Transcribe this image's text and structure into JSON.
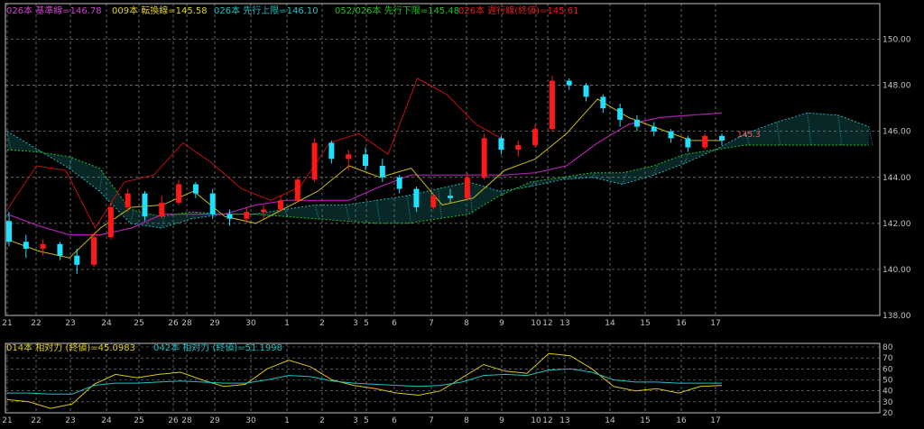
{
  "main_legend": [
    {
      "text": "026本 基準線=146.78",
      "color": "#d040d0"
    },
    {
      "text": "009本 転換線=145.58",
      "color": "#e0d020"
    },
    {
      "text": "026本 先行上限=146.10",
      "color": "#20c0c0"
    },
    {
      "text": "052/026本 先行下限=145.48",
      "color": "#20c020"
    },
    {
      "text": "026本 遅行線(終値)=145.61",
      "color": "#e02020"
    }
  ],
  "sub_legend": [
    {
      "text": "014本 相対力 (終値)=45.0983",
      "color": "#e0d020"
    },
    {
      "text": "042本 相対力 (終値)=51.1998",
      "color": "#20c0c0"
    }
  ],
  "price_label": "145.3",
  "colors": {
    "up": "#ff1818",
    "down": "#20e0ff",
    "grid": "#8a8a8a",
    "axis": "#c0c0c0",
    "kumo": "#2ab0b0"
  },
  "chart_data": [
    {
      "type": "candlestick",
      "ylim": [
        138,
        151
      ],
      "yticks": [
        138,
        140,
        142,
        144,
        146,
        148,
        150
      ],
      "ytick_labels": [
        "138.00",
        "140.00",
        "142.00",
        "144.00",
        "146.00",
        "148.00",
        "150.00"
      ],
      "xtick_labels": [
        "21",
        "22",
        "23",
        "24",
        "25",
        "26",
        "28",
        "29",
        "30",
        "1",
        "2",
        "3",
        "5",
        "6",
        "7",
        "8",
        "9",
        "10",
        "12",
        "13",
        "14",
        "15",
        "16",
        "17"
      ],
      "series": [
        {
          "name": "基準線",
          "values": [
            142.4,
            141.9,
            141.5,
            141.5,
            141.8,
            142.4,
            142.4,
            142.4,
            142.8,
            143.0,
            143.0,
            143.0,
            143.6,
            144.1,
            144.1,
            144.1,
            144.1,
            144.2,
            144.5,
            145.5,
            146.3,
            146.6,
            146.7,
            146.8
          ]
        },
        {
          "name": "転換線",
          "values": [
            141.3,
            140.8,
            140.5,
            141.8,
            142.7,
            142.8,
            143.4,
            142.3,
            142.0,
            142.7,
            143.4,
            144.5,
            144.0,
            144.4,
            142.8,
            143.1,
            144.3,
            144.8,
            145.9,
            147.4,
            146.6,
            146.1,
            145.6,
            145.6
          ]
        },
        {
          "name": "先行上限",
          "values": [
            146.0,
            145.2,
            144.4,
            143.4,
            142.0,
            141.8,
            142.2,
            142.4,
            142.4,
            142.6,
            142.8,
            142.8,
            143.0,
            143.2,
            143.5,
            143.8,
            143.4,
            143.6,
            143.9,
            144.0,
            143.7,
            144.1,
            144.6,
            145.2,
            145.9,
            146.4,
            146.8,
            146.7,
            146.2
          ]
        },
        {
          "name": "先行下限",
          "values": [
            145.2,
            145.1,
            144.9,
            144.4,
            142.6,
            142.3,
            142.5,
            142.4,
            142.4,
            142.3,
            142.2,
            142.1,
            142.0,
            142.0,
            142.2,
            142.4,
            143.2,
            143.8,
            144.0,
            144.2,
            144.2,
            144.5,
            145.0,
            145.2,
            145.4,
            145.4,
            145.4,
            145.4,
            145.4
          ]
        },
        {
          "name": "遅行線",
          "values": [
            142.6,
            144.5,
            144.3,
            141.8,
            143.8,
            144.1,
            145.5,
            144.6,
            143.5,
            143.0,
            143.6,
            145.5,
            145.9,
            145.0,
            148.3,
            147.6,
            146.3,
            145.6
          ]
        },
        {
          "name": "ohlc",
          "values": [
            [
              142.1,
              142.5,
              141.0,
              141.2
            ],
            [
              141.2,
              141.5,
              140.5,
              140.9
            ],
            [
              140.9,
              141.3,
              140.6,
              141.1
            ],
            [
              141.1,
              141.2,
              140.4,
              140.6
            ],
            [
              140.6,
              140.9,
              139.8,
              140.2
            ],
            [
              140.2,
              141.6,
              140.1,
              141.4
            ],
            [
              141.4,
              142.9,
              141.3,
              142.7
            ],
            [
              142.7,
              143.5,
              142.5,
              143.3
            ],
            [
              143.3,
              143.4,
              142.1,
              142.3
            ],
            [
              142.3,
              143.2,
              142.2,
              142.9
            ],
            [
              142.9,
              143.9,
              142.8,
              143.7
            ],
            [
              143.7,
              143.8,
              143.1,
              143.3
            ],
            [
              143.3,
              143.5,
              142.2,
              142.4
            ],
            [
              142.4,
              142.6,
              141.9,
              142.2
            ],
            [
              142.2,
              142.7,
              142.0,
              142.5
            ],
            [
              142.5,
              142.8,
              142.2,
              142.6
            ],
            [
              142.6,
              143.2,
              142.5,
              143.0
            ],
            [
              143.0,
              144.0,
              142.9,
              143.9
            ],
            [
              143.9,
              145.7,
              143.8,
              145.5
            ],
            [
              145.5,
              145.6,
              144.6,
              144.8
            ],
            [
              144.8,
              145.2,
              144.3,
              145.0
            ],
            [
              145.0,
              145.3,
              144.3,
              144.5
            ],
            [
              144.5,
              144.8,
              143.8,
              144.0
            ],
            [
              144.0,
              144.1,
              143.3,
              143.5
            ],
            [
              143.5,
              143.6,
              142.5,
              142.7
            ],
            [
              142.7,
              143.3,
              142.6,
              143.2
            ],
            [
              143.2,
              143.5,
              142.9,
              143.1
            ],
            [
              143.1,
              144.2,
              143.0,
              144.0
            ],
            [
              144.0,
              145.9,
              143.9,
              145.7
            ],
            [
              145.7,
              145.8,
              145.0,
              145.2
            ],
            [
              145.2,
              145.6,
              144.9,
              145.4
            ],
            [
              145.4,
              146.3,
              145.3,
              146.1
            ],
            [
              146.1,
              148.4,
              146.0,
              148.2
            ],
            [
              148.2,
              148.3,
              147.8,
              148.0
            ],
            [
              148.0,
              148.1,
              147.3,
              147.5
            ],
            [
              147.5,
              147.6,
              146.8,
              147.0
            ],
            [
              147.0,
              147.2,
              146.2,
              146.5
            ],
            [
              146.5,
              146.7,
              146.0,
              146.2
            ],
            [
              146.2,
              146.4,
              145.8,
              146.0
            ],
            [
              146.0,
              146.1,
              145.5,
              145.7
            ],
            [
              145.7,
              145.8,
              145.1,
              145.3
            ],
            [
              145.3,
              145.9,
              145.2,
              145.8
            ],
            [
              145.8,
              145.9,
              145.4,
              145.6
            ]
          ]
        }
      ]
    },
    {
      "type": "line",
      "ylim": [
        20,
        80
      ],
      "yticks": [
        20,
        30,
        40,
        50,
        60,
        70,
        80
      ],
      "ytick_labels": [
        "20",
        "30",
        "40",
        "50",
        "60",
        "70",
        "80"
      ],
      "series": [
        {
          "name": "014本 相対力",
          "values": [
            32,
            30,
            24,
            28,
            46,
            55,
            52,
            55,
            57,
            50,
            44,
            46,
            60,
            68,
            62,
            50,
            45,
            42,
            38,
            36,
            40,
            52,
            64,
            58,
            56,
            74,
            72,
            60,
            44,
            40,
            42,
            38,
            44,
            45
          ]
        },
        {
          "name": "042本 相対力",
          "values": [
            38,
            38,
            37,
            37,
            45,
            47,
            47,
            48,
            49,
            48,
            47,
            47,
            50,
            54,
            53,
            49,
            47,
            46,
            45,
            44,
            45,
            48,
            54,
            55,
            54,
            59,
            60,
            57,
            50,
            48,
            48,
            47,
            47,
            47
          ]
        }
      ]
    }
  ]
}
